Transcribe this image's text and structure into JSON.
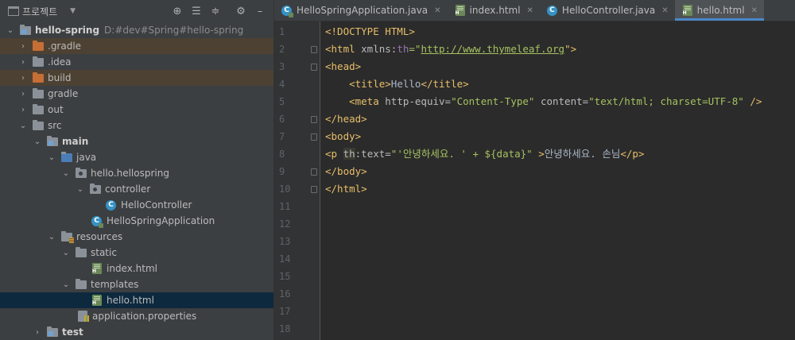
{
  "project_panel": {
    "title": "프로젝트",
    "tools": [
      "locate-icon",
      "expand-all-icon",
      "collapse-all-icon",
      "settings-icon",
      "minimize-icon"
    ]
  },
  "tree": [
    {
      "label": "hello-spring",
      "path": "D:#dev#Spring#hello-spring",
      "icon": "module-folder-icon"
    },
    {
      "label": ".gradle",
      "icon": "excluded-folder-icon"
    },
    {
      "label": ".idea",
      "icon": "folder-icon"
    },
    {
      "label": "build",
      "icon": "excluded-folder-icon"
    },
    {
      "label": "gradle",
      "icon": "folder-icon"
    },
    {
      "label": "out",
      "icon": "folder-icon"
    },
    {
      "label": "src",
      "icon": "folder-icon"
    },
    {
      "label": "main",
      "icon": "source-folder-icon"
    },
    {
      "label": "java",
      "icon": "source-root-icon"
    },
    {
      "label": "hello.hellospring",
      "icon": "package-icon"
    },
    {
      "label": "controller",
      "icon": "package-icon"
    },
    {
      "label": "HelloController",
      "icon": "class-icon"
    },
    {
      "label": "HelloSpringApplication",
      "icon": "spring-class-icon"
    },
    {
      "label": "resources",
      "icon": "resources-folder-icon"
    },
    {
      "label": "static",
      "icon": "folder-icon"
    },
    {
      "label": "index.html",
      "icon": "html-file-icon"
    },
    {
      "label": "templates",
      "icon": "folder-icon"
    },
    {
      "label": "hello.html",
      "icon": "html-file-icon"
    },
    {
      "label": "application.properties",
      "icon": "properties-file-icon"
    },
    {
      "label": "test",
      "icon": "source-folder-icon"
    }
  ],
  "tabs": [
    {
      "label": "HelloSpringApplication.java",
      "icon": "spring-class-icon",
      "active": false
    },
    {
      "label": "index.html",
      "icon": "html-file-icon",
      "active": false
    },
    {
      "label": "HelloController.java",
      "icon": "class-icon",
      "active": false
    },
    {
      "label": "hello.html",
      "icon": "html-file-icon",
      "active": true
    }
  ],
  "editor": {
    "line_numbers": [
      "1",
      "2",
      "3",
      "4",
      "5",
      "6",
      "7",
      "8",
      "9",
      "10",
      "11",
      "12",
      "13",
      "14",
      "15",
      "16",
      "17",
      "18"
    ],
    "code": {
      "l1": {
        "text": "<!DOCTYPE HTML>"
      },
      "l2": {
        "open": "<html ",
        "attr": "xmlns:",
        "ns": "th",
        "eq": "=\"",
        "url": "http://www.thymeleaf.org",
        "close": "\">"
      },
      "l3": {
        "tag": "<head>"
      },
      "l4": {
        "open": "<title>",
        "text": "Hello",
        "close": "</title>"
      },
      "l5": {
        "open": "<meta ",
        "a1": "http-equiv=",
        "v1": "\"Content-Type\"",
        "a2": " content=",
        "v2": "\"text/html; charset=UTF-8\"",
        "close": " />"
      },
      "l6": {
        "tag": "</head>"
      },
      "l7": {
        "tag": "<body>"
      },
      "l8": {
        "open": "<p ",
        "ns": "th",
        "attr": ":text=",
        "val": "\"'안녕하세요. ' + ${data}\"",
        "gt": " >",
        "text": "안녕하세요. 손님",
        "close": "</p>"
      },
      "l9": {
        "tag": "</body>"
      },
      "l10": {
        "tag": "</html>"
      }
    }
  },
  "colors": {
    "panel_bg": "#3c3f41",
    "editor_bg": "#2b2b2b",
    "tag": "#e8bf6a",
    "attr_value": "#a5c261",
    "selection": "#0d293e",
    "excluded_highlight": "#4c4132",
    "active_tab_accent": "#4a88c7"
  }
}
